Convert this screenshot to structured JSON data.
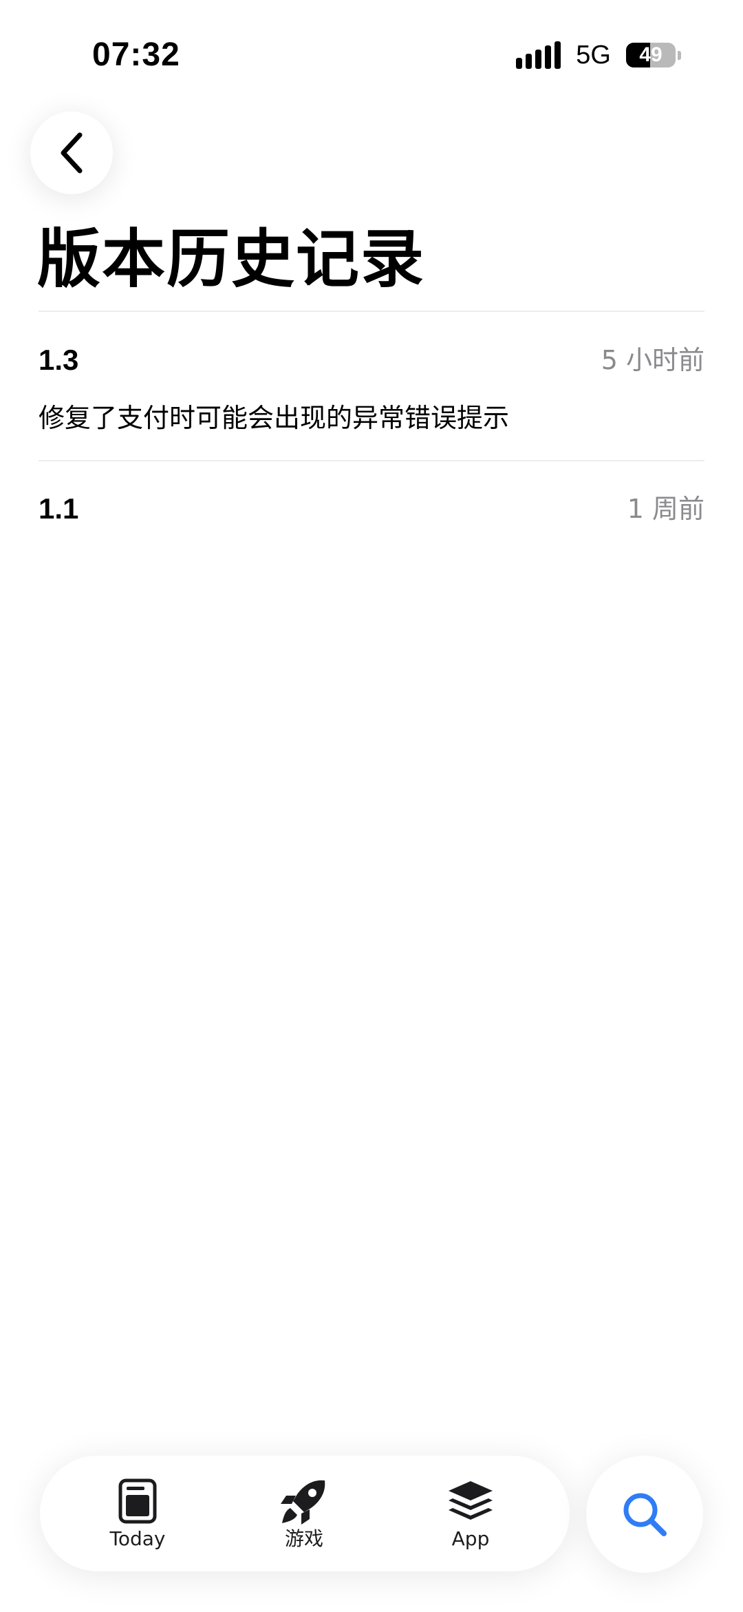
{
  "status_bar": {
    "time": "07:32",
    "network": "5G",
    "battery_level": "49",
    "battery_fraction": 0.49
  },
  "nav": {
    "back_icon": "chevron-left-icon"
  },
  "page": {
    "title": "版本历史记录"
  },
  "versions": [
    {
      "version": "1.3",
      "date": "5 小时前",
      "notes": "修复了支付时可能会出现的异常错误提示"
    },
    {
      "version": "1.1",
      "date": "1 周前"
    }
  ],
  "tab_bar": {
    "tabs": [
      {
        "label": "Today",
        "icon": "today-icon"
      },
      {
        "label": "游戏",
        "icon": "rocket-icon"
      },
      {
        "label": "App",
        "icon": "stack-icon"
      }
    ],
    "search_icon": "search-icon"
  },
  "colors": {
    "secondary_text": "#8a8a8e",
    "accent": "#2f7cf6",
    "divider": "#ececec"
  }
}
